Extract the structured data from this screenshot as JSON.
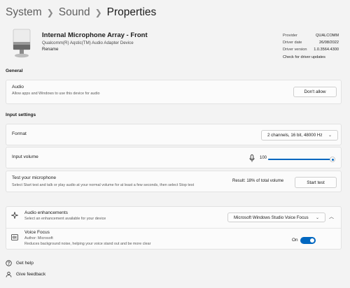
{
  "breadcrumb": {
    "items": [
      "System",
      "Sound",
      "Properties"
    ]
  },
  "device": {
    "name": "Internal Microphone Array - Front",
    "adapter": "Qualcomm(R) Aqstic(TM) Audio Adapter Device",
    "rename_label": "Rename"
  },
  "driver_info": {
    "provider_label": "Provider",
    "provider_value": "QUALCOMM",
    "date_label": "Driver date",
    "date_value": "26/08/2022",
    "version_label": "Driver version",
    "version_value": "1.0.3564.4300",
    "update_link": "Check for driver updates"
  },
  "general": {
    "heading": "General",
    "audio_label": "Audio",
    "audio_desc": "Allow apps and Windows to use this device for audio",
    "dont_allow_label": "Don't allow"
  },
  "input_settings": {
    "heading": "Input settings",
    "format_label": "Format",
    "format_value": "2 channels, 16 bit, 48000 Hz",
    "volume_label": "Input volume",
    "volume_value": "100",
    "volume_level": 100,
    "test_label": "Test your microphone",
    "test_desc": "Select Start test and talk or play audio at your normal volume for at least a few seconds, then select Stop test",
    "test_result": "Result: 18% of total volume",
    "start_test_label": "Start test"
  },
  "enhancements": {
    "label": "Audio enhancements",
    "desc": "Select an enhancement available for your device",
    "selected": "Microsoft Windows Studio Voice Focus",
    "voice_focus_label": "Voice Focus",
    "voice_focus_author": "Author: Microsoft",
    "voice_focus_desc": "Reduces background noise, helping your voice stand out and be more clear",
    "toggle_state": "On",
    "toggle_on": true
  },
  "footer": {
    "help_label": "Get help",
    "feedback_label": "Give feedback"
  },
  "colors": {
    "accent": "#0067c0",
    "background": "#f3f3f3",
    "card": "#fbfbfb"
  },
  "icons": [
    "microphone-device-icon",
    "microphone-icon",
    "sparkle-icon",
    "waveform-icon",
    "help-icon",
    "feedback-icon",
    "chevron-down-icon",
    "chevron-up-icon"
  ]
}
